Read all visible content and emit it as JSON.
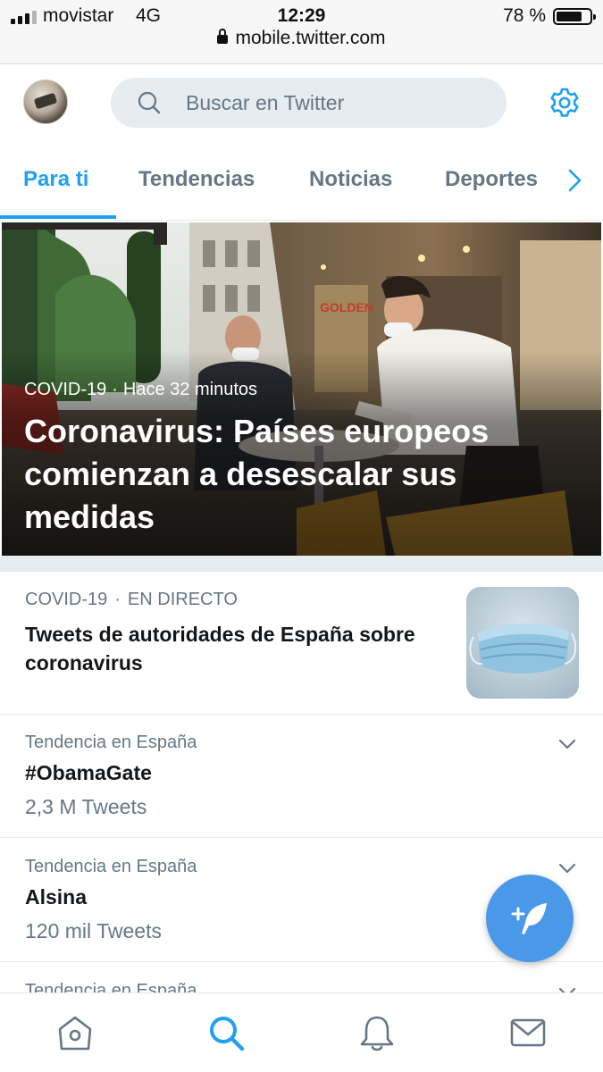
{
  "status_bar": {
    "carrier": "movistar",
    "network": "4G",
    "time": "12:29",
    "battery_text": "78 %",
    "battery_level": 0.78,
    "url": "mobile.twitter.com",
    "icons": [
      "signal-icon",
      "lock-icon",
      "battery-icon"
    ]
  },
  "header": {
    "search_placeholder": "Buscar en Twitter",
    "icons": [
      "avatar",
      "search-icon",
      "gear-icon"
    ],
    "accent_color": "#1da1f2"
  },
  "tabs": [
    {
      "label": "Para ti",
      "active": true
    },
    {
      "label": "Tendencias",
      "active": false
    },
    {
      "label": "Noticias",
      "active": false
    },
    {
      "label": "Deportes",
      "active": false
    }
  ],
  "hero": {
    "category": "COVID-19",
    "separator": "·",
    "time": "Hace 32 minutos",
    "title": "Coronavirus: Países europeos comienzan a desescalar sus medidas",
    "photo_sign": "GOLDEN"
  },
  "story": {
    "category": "COVID-19",
    "separator": "·",
    "status": "EN DIRECTO",
    "title": "Tweets de autoridades de España sobre coronavirus"
  },
  "trends": [
    {
      "context": "Tendencia en España",
      "name": "#ObamaGate",
      "count": "2,3 M Tweets"
    },
    {
      "context": "Tendencia en España",
      "name": "Alsina",
      "count": "120 mil Tweets"
    },
    {
      "context": "Tendencia en España",
      "name": "",
      "count": ""
    }
  ],
  "bottom_nav": {
    "icons": [
      "home-icon",
      "search-icon",
      "notifications-icon",
      "messages-icon"
    ],
    "active": "search-icon"
  },
  "fab": {
    "icon": "compose-tweet-icon"
  }
}
